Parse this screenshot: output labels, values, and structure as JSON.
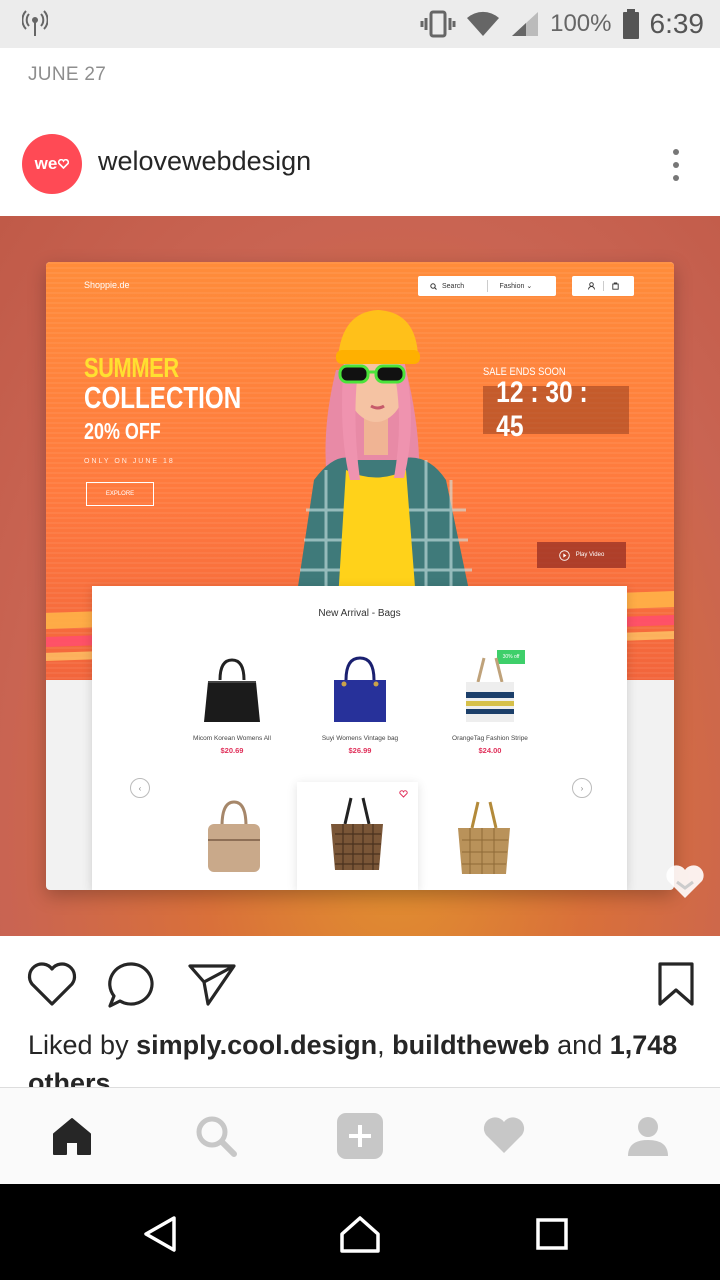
{
  "status_bar": {
    "battery_percent": "100%",
    "time": "6:39",
    "icons": [
      "antenna-icon",
      "vibrate-icon",
      "wifi-icon",
      "signal-icon",
      "battery-icon"
    ]
  },
  "feed": {
    "date": "JUNE 27"
  },
  "post": {
    "avatar_text": "we",
    "username": "welovewebdesign",
    "image": {
      "brand": "Shoppie.de",
      "search_label": "Search",
      "category_label": "Fashion",
      "headline_1": "SUMMER",
      "headline_2": "COLLECTION",
      "discount": "20% OFF",
      "tagline": "ONLY ON JUNE 18",
      "cta": "EXPLORE",
      "sale_label": "SALE ENDS SOON",
      "timer": "12 : 30 : 45",
      "play_label": "Play Video",
      "panel_title": "New Arrival - Bags",
      "badge": "30% off",
      "products": [
        {
          "name": "Micom Korean Womens All",
          "price": "$20.69"
        },
        {
          "name": "Suyi Womens Vintage bag",
          "price": "$26.99"
        },
        {
          "name": "OrangeTag Fashion Stripe",
          "price": "$24.00"
        }
      ]
    },
    "likes": {
      "prefix": "Liked by ",
      "user1": "simply.cool.design",
      "sep": ", ",
      "user2": "buildtheweb",
      "and": " and ",
      "count": "1,748",
      "suffix": " others"
    }
  },
  "colors": {
    "avatar": "#ff4a55",
    "price": "#e0305a",
    "hero_orange": "#ff8c3a",
    "summer_yellow": "#ffe030"
  },
  "bottom_nav": [
    "home-icon",
    "search-icon",
    "add-icon",
    "activity-heart-icon",
    "profile-icon"
  ],
  "android_nav": [
    "back-icon",
    "home-icon",
    "recents-icon"
  ]
}
